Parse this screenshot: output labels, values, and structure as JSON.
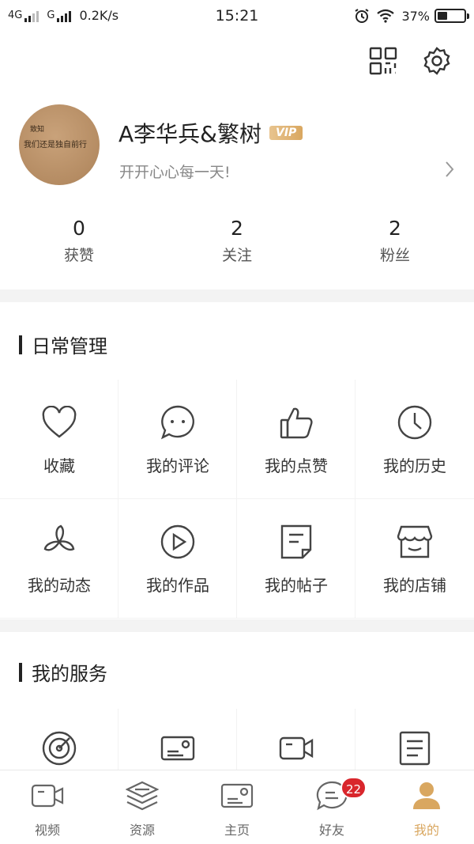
{
  "status_bar": {
    "network1": "4G",
    "network2": "G",
    "speed": "0.2K/s",
    "time": "15:21",
    "battery": "37%",
    "battery_fraction": 0.37
  },
  "top_actions": {
    "qr_icon": "qr-code-icon",
    "settings_icon": "gear-icon"
  },
  "profile": {
    "avatar_text_line1": "致知",
    "avatar_text_line2": "我们还是独自前行",
    "username": "A李华兵&繁树",
    "vip_label": "VIP",
    "motto": "开开心心每一天!"
  },
  "stats": [
    {
      "value": "0",
      "label": "获赞"
    },
    {
      "value": "2",
      "label": "关注"
    },
    {
      "value": "2",
      "label": "粉丝"
    }
  ],
  "daily": {
    "title": "日常管理",
    "items": [
      {
        "label": "收藏",
        "icon": "heart-icon"
      },
      {
        "label": "我的评论",
        "icon": "comment-icon"
      },
      {
        "label": "我的点赞",
        "icon": "thumbs-up-icon"
      },
      {
        "label": "我的历史",
        "icon": "clock-icon"
      },
      {
        "label": "我的动态",
        "icon": "pinwheel-icon"
      },
      {
        "label": "我的作品",
        "icon": "play-circle-icon"
      },
      {
        "label": "我的帖子",
        "icon": "note-icon"
      },
      {
        "label": "我的店铺",
        "icon": "store-icon"
      }
    ]
  },
  "services": {
    "title": "我的服务",
    "items": [
      {
        "icon": "radar-icon"
      },
      {
        "icon": "card-icon"
      },
      {
        "icon": "video-camera-icon"
      },
      {
        "icon": "document-icon"
      }
    ]
  },
  "tabbar": {
    "tabs": [
      {
        "label": "视频",
        "icon": "video-camera-icon"
      },
      {
        "label": "资源",
        "icon": "layers-icon"
      },
      {
        "label": "主页",
        "icon": "card-icon"
      },
      {
        "label": "好友",
        "icon": "chat-icon",
        "badge": "22"
      },
      {
        "label": "我的",
        "icon": "person-icon",
        "active": true
      }
    ]
  },
  "colors": {
    "accent_gold": "#d9a760",
    "badge_red": "#d9262c"
  }
}
